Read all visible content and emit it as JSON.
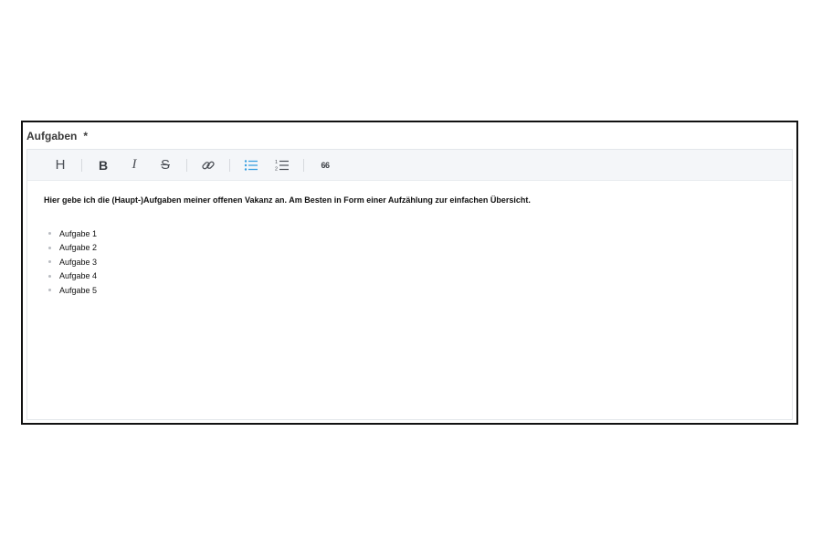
{
  "field": {
    "label": "Aufgaben",
    "required_mark": "*"
  },
  "toolbar": {
    "buttons": [
      {
        "name": "heading",
        "icon": "heading-icon",
        "glyph": "H"
      },
      {
        "name": "bold",
        "icon": "bold-icon",
        "glyph": "B"
      },
      {
        "name": "italic",
        "icon": "italic-icon",
        "glyph": "I"
      },
      {
        "name": "strikethrough",
        "icon": "strikethrough-icon",
        "glyph": "S"
      },
      {
        "name": "link",
        "icon": "link-icon"
      },
      {
        "name": "bullet-list",
        "icon": "bullet-list-icon",
        "active": true
      },
      {
        "name": "numbered-list",
        "icon": "numbered-list-icon"
      },
      {
        "name": "quote",
        "icon": "quote-icon",
        "glyph": "66"
      }
    ],
    "active_color": "#3aa0e0"
  },
  "editor": {
    "intro": "Hier gebe ich die (Haupt-)Aufgaben meiner offenen Vakanz an. Am Besten in Form einer Aufzählung zur einfachen Übersicht.",
    "items": [
      "Aufgabe 1",
      "Aufgabe 2",
      "Aufgabe 3",
      "Aufgabe 4",
      "Aufgabe 5"
    ]
  }
}
